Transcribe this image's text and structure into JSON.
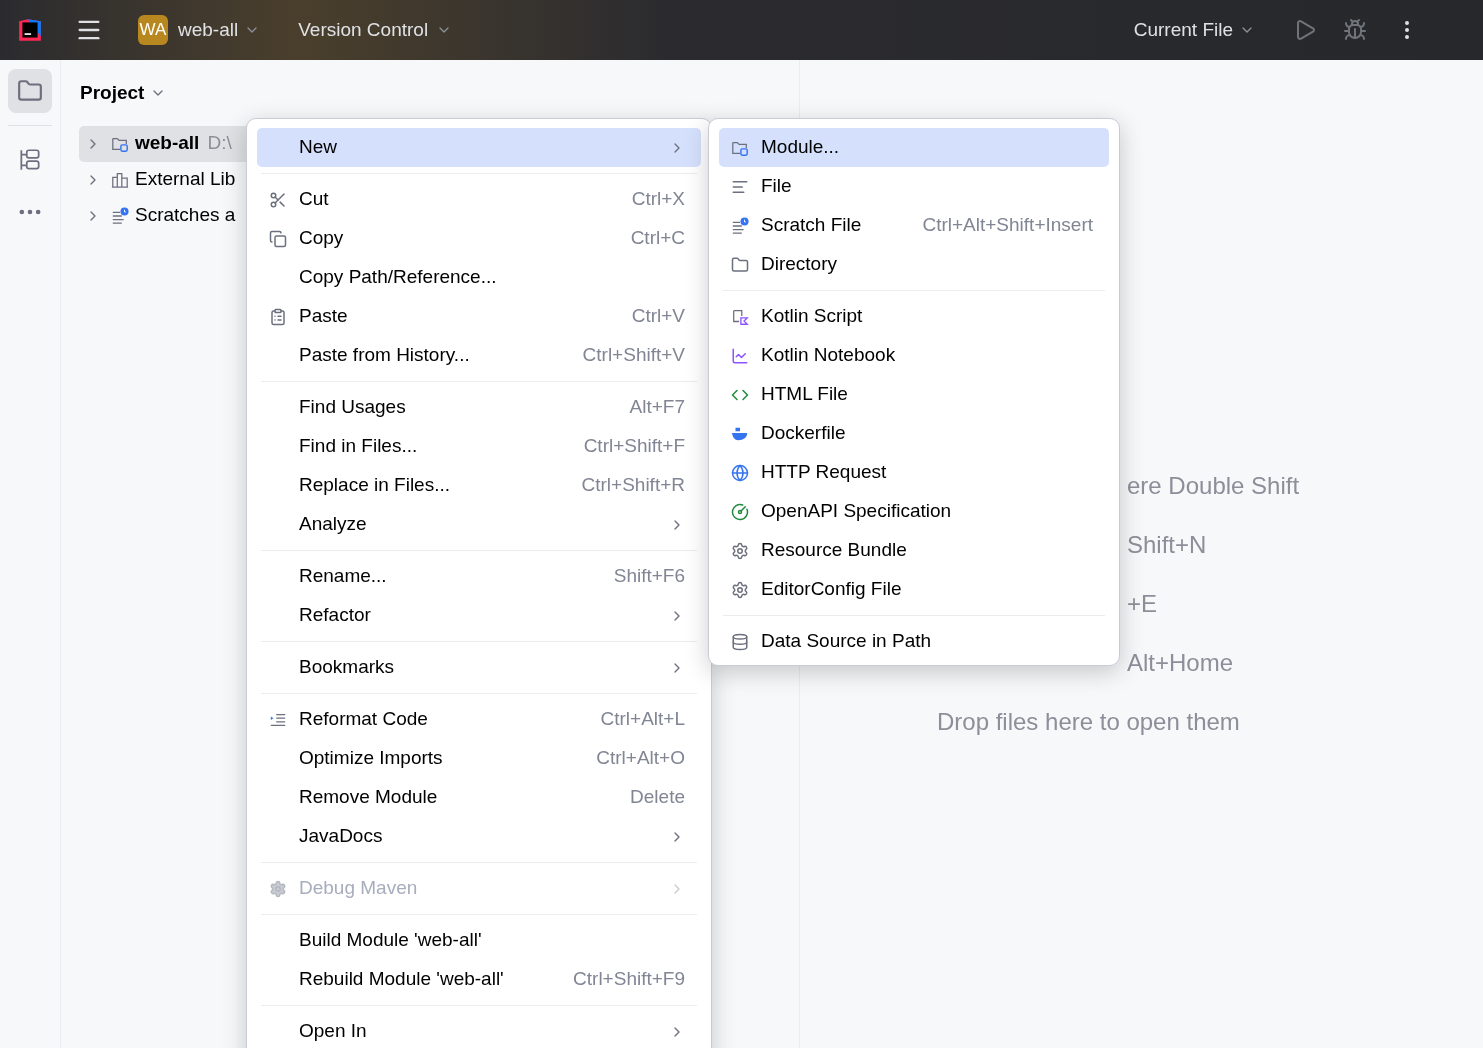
{
  "toolbar": {
    "project_badge": "WA",
    "project": "web-all",
    "vcs": "Version Control",
    "run_config": "Current File"
  },
  "sidebar": {
    "items": [
      {
        "selected": true
      },
      {
        "selected": false
      }
    ]
  },
  "project_panel": {
    "title": "Project",
    "tree": [
      {
        "name": "web-all",
        "path": "D:\\",
        "selected": true
      },
      {
        "name": "External Lib",
        "selected": false
      },
      {
        "name": "Scratches a",
        "selected": false
      }
    ]
  },
  "editor_hints": [
    {
      "text": "ere Double Shift",
      "kind": "cut"
    },
    {
      "text": "Shift+N",
      "kind": "cut"
    },
    {
      "text": "+E",
      "kind": "cut"
    },
    {
      "text": "Alt+Home",
      "kind": "cut"
    },
    {
      "text": "Drop files here to open them",
      "kind": "full"
    }
  ],
  "context_menu": [
    {
      "kind": "item",
      "label": "New",
      "submenu": true,
      "selected": true,
      "disabled": false
    },
    {
      "kind": "separator"
    },
    {
      "kind": "item",
      "label": "Cut",
      "shortcut": "Ctrl+X",
      "submenu": false,
      "selected": false,
      "disabled": false
    },
    {
      "kind": "item",
      "label": "Copy",
      "shortcut": "Ctrl+C",
      "submenu": false,
      "selected": false,
      "disabled": false
    },
    {
      "kind": "item",
      "label": "Copy Path/Reference...",
      "submenu": false,
      "selected": false,
      "disabled": false
    },
    {
      "kind": "item",
      "label": "Paste",
      "shortcut": "Ctrl+V",
      "submenu": false,
      "selected": false,
      "disabled": false
    },
    {
      "kind": "item",
      "label": "Paste from History...",
      "shortcut": "Ctrl+Shift+V",
      "submenu": false,
      "selected": false,
      "disabled": false
    },
    {
      "kind": "separator"
    },
    {
      "kind": "item",
      "label": "Find Usages",
      "shortcut": "Alt+F7",
      "submenu": false,
      "selected": false,
      "disabled": false
    },
    {
      "kind": "item",
      "label": "Find in Files...",
      "shortcut": "Ctrl+Shift+F",
      "submenu": false,
      "selected": false,
      "disabled": false
    },
    {
      "kind": "item",
      "label": "Replace in Files...",
      "shortcut": "Ctrl+Shift+R",
      "submenu": false,
      "selected": false,
      "disabled": false
    },
    {
      "kind": "item",
      "label": "Analyze",
      "submenu": true,
      "selected": false,
      "disabled": false
    },
    {
      "kind": "separator"
    },
    {
      "kind": "item",
      "label": "Rename...",
      "shortcut": "Shift+F6",
      "submenu": false,
      "selected": false,
      "disabled": false
    },
    {
      "kind": "item",
      "label": "Refactor",
      "submenu": true,
      "selected": false,
      "disabled": false
    },
    {
      "kind": "separator"
    },
    {
      "kind": "item",
      "label": "Bookmarks",
      "submenu": true,
      "selected": false,
      "disabled": false
    },
    {
      "kind": "separator"
    },
    {
      "kind": "item",
      "label": "Reformat Code",
      "shortcut": "Ctrl+Alt+L",
      "submenu": false,
      "selected": false,
      "disabled": false
    },
    {
      "kind": "item",
      "label": "Optimize Imports",
      "shortcut": "Ctrl+Alt+O",
      "submenu": false,
      "selected": false,
      "disabled": false
    },
    {
      "kind": "item",
      "label": "Remove Module",
      "shortcut": "Delete",
      "submenu": false,
      "selected": false,
      "disabled": false
    },
    {
      "kind": "item",
      "label": "JavaDocs",
      "submenu": true,
      "selected": false,
      "disabled": false
    },
    {
      "kind": "separator"
    },
    {
      "kind": "item",
      "label": "Debug Maven",
      "submenu": true,
      "selected": false,
      "disabled": true
    },
    {
      "kind": "separator"
    },
    {
      "kind": "item",
      "label": "Build Module 'web-all'",
      "submenu": false,
      "selected": false,
      "disabled": false
    },
    {
      "kind": "item",
      "label": "Rebuild Module 'web-all'",
      "shortcut": "Ctrl+Shift+F9",
      "submenu": false,
      "selected": false,
      "disabled": false
    },
    {
      "kind": "separator"
    },
    {
      "kind": "item",
      "label": "Open In",
      "submenu": true,
      "selected": false,
      "disabled": false
    }
  ],
  "new_submenu": [
    {
      "kind": "item",
      "label": "Module...",
      "selected": true
    },
    {
      "kind": "item",
      "label": "File",
      "selected": false
    },
    {
      "kind": "item",
      "label": "Scratch File",
      "shortcut": "Ctrl+Alt+Shift+Insert",
      "selected": false
    },
    {
      "kind": "item",
      "label": "Directory",
      "selected": false
    },
    {
      "kind": "separator"
    },
    {
      "kind": "item",
      "label": "Kotlin Script",
      "selected": false
    },
    {
      "kind": "item",
      "label": "Kotlin Notebook",
      "selected": false
    },
    {
      "kind": "item",
      "label": "HTML File",
      "selected": false
    },
    {
      "kind": "item",
      "label": "Dockerfile",
      "selected": false
    },
    {
      "kind": "item",
      "label": "HTTP Request",
      "selected": false
    },
    {
      "kind": "item",
      "label": "OpenAPI Specification",
      "selected": false
    },
    {
      "kind": "item",
      "label": "Resource Bundle",
      "selected": false
    },
    {
      "kind": "item",
      "label": "EditorConfig File",
      "selected": false
    },
    {
      "kind": "separator"
    },
    {
      "kind": "item",
      "label": "Data Source in Path",
      "selected": false
    }
  ]
}
